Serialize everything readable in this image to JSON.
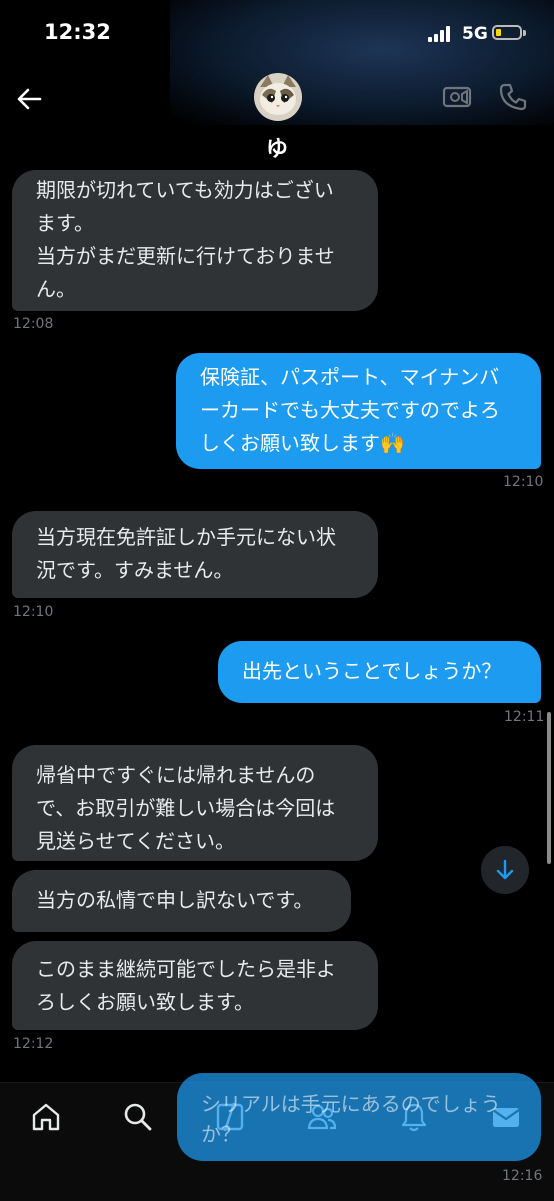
{
  "status_bar": {
    "time": "12:32",
    "network": "5G"
  },
  "header": {
    "contact_name": "ゆ"
  },
  "messages": [
    {
      "dir": "received",
      "text": "期限が切れていても効力はござい\nます。\n当方がまだ更新に行けておりませ\nん。",
      "time": "12:08"
    },
    {
      "dir": "sent",
      "text": "保険証、パスポート、マイナンバ\nーカードでも大丈夫ですのでよろ\nしくお願い致します🙌",
      "time": "12:10"
    },
    {
      "dir": "received",
      "text": "当方現在免許証しか手元にない状\n況です。すみません。",
      "time": "12:10"
    },
    {
      "dir": "sent",
      "text": "出先ということでしょうか？",
      "time": "12:11"
    },
    {
      "dir": "received",
      "text": "帰省中ですぐには帰れませんの\nで、お取引が難しい場合は今回は\n見送らせてください。",
      "time": ""
    },
    {
      "dir": "received",
      "text": "当方の私情で申し訳ないです。",
      "time": ""
    },
    {
      "dir": "received",
      "text": "このまま継続可能でしたら是非よ\nろしくお願い致します。",
      "time": "12:12"
    },
    {
      "dir": "sent",
      "text": "シリアルは手元にあるのでしょう\nか？",
      "time": "12:16"
    }
  ],
  "tabbar": {
    "icons": [
      "home-icon",
      "search-icon",
      "grok-icon",
      "communities-icon",
      "notifications-icon",
      "messages-icon"
    ]
  },
  "colors": {
    "accent": "#1d9bf0",
    "received_bubble": "#2f3336",
    "background": "#000000"
  }
}
